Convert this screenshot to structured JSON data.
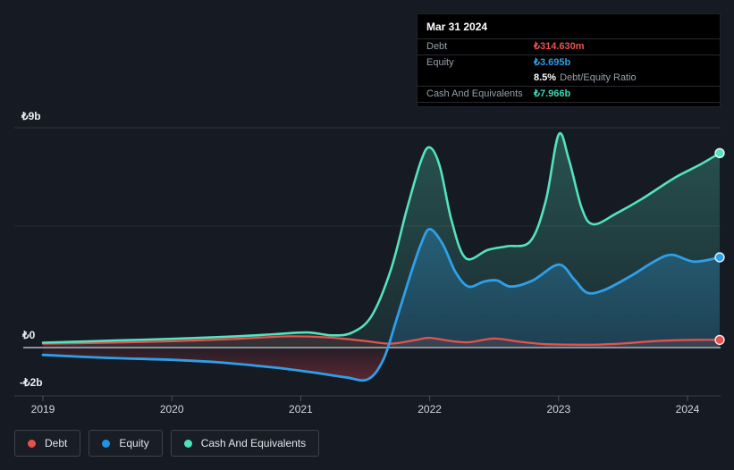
{
  "tooltip": {
    "date": "Mar 31 2024",
    "debt": {
      "label": "Debt",
      "value": "₺314.630m",
      "color": "#e8534e"
    },
    "equity": {
      "label": "Equity",
      "value": "₺3.695b",
      "color": "#2d9fe8"
    },
    "ratio": {
      "value": "8.5%",
      "label": "Debt/Equity Ratio"
    },
    "cash": {
      "label": "Cash And Equivalents",
      "value": "₺7.966b",
      "color": "#3bd6b3"
    }
  },
  "legend": {
    "items": [
      {
        "label": "Debt",
        "color": "#e4524e"
      },
      {
        "label": "Equity",
        "color": "#2391e5"
      },
      {
        "label": "Cash And Equivalents",
        "color": "#4fe0bd"
      }
    ]
  },
  "chart_data": {
    "type": "area",
    "x_axis": {
      "labels": [
        "2019",
        "2020",
        "2021",
        "2022",
        "2023",
        "2024"
      ],
      "range": [
        2019,
        2024.25
      ]
    },
    "y_axis": {
      "unit": "₺ billions",
      "labels": [
        {
          "text": "₺9b",
          "value": 9
        },
        {
          "text": "₺0",
          "value": 0
        },
        {
          "text": "-₺2b",
          "value": -2
        }
      ],
      "ylim": [
        -2,
        9
      ],
      "gridline_values": [
        9,
        5,
        0
      ]
    },
    "series": [
      {
        "key": "debt",
        "name": "Debt",
        "color": "#e4524e",
        "points": [
          [
            2019.0,
            0.16
          ],
          [
            2019.5,
            0.2
          ],
          [
            2020.0,
            0.26
          ],
          [
            2020.5,
            0.36
          ],
          [
            2020.9,
            0.46
          ],
          [
            2021.2,
            0.42
          ],
          [
            2021.5,
            0.27
          ],
          [
            2021.7,
            0.16
          ],
          [
            2021.9,
            0.32
          ],
          [
            2022.0,
            0.4
          ],
          [
            2022.15,
            0.28
          ],
          [
            2022.3,
            0.22
          ],
          [
            2022.5,
            0.37
          ],
          [
            2022.7,
            0.24
          ],
          [
            2022.9,
            0.14
          ],
          [
            2023.1,
            0.12
          ],
          [
            2023.3,
            0.12
          ],
          [
            2023.5,
            0.17
          ],
          [
            2023.7,
            0.25
          ],
          [
            2023.9,
            0.3
          ],
          [
            2024.1,
            0.32
          ],
          [
            2024.25,
            0.315
          ]
        ]
      },
      {
        "key": "equity",
        "name": "Equity",
        "color": "#2f9fe8",
        "points": [
          [
            2019.0,
            -0.3
          ],
          [
            2019.5,
            -0.42
          ],
          [
            2020.0,
            -0.5
          ],
          [
            2020.4,
            -0.62
          ],
          [
            2020.8,
            -0.82
          ],
          [
            2021.1,
            -1.02
          ],
          [
            2021.35,
            -1.22
          ],
          [
            2021.52,
            -1.3
          ],
          [
            2021.64,
            -0.5
          ],
          [
            2021.74,
            1.1
          ],
          [
            2021.84,
            2.8
          ],
          [
            2021.93,
            4.2
          ],
          [
            2022.0,
            4.85
          ],
          [
            2022.1,
            4.25
          ],
          [
            2022.2,
            3.1
          ],
          [
            2022.3,
            2.5
          ],
          [
            2022.42,
            2.7
          ],
          [
            2022.52,
            2.75
          ],
          [
            2022.63,
            2.5
          ],
          [
            2022.8,
            2.75
          ],
          [
            2023.0,
            3.4
          ],
          [
            2023.12,
            2.8
          ],
          [
            2023.22,
            2.25
          ],
          [
            2023.35,
            2.35
          ],
          [
            2023.55,
            2.9
          ],
          [
            2023.75,
            3.55
          ],
          [
            2023.88,
            3.8
          ],
          [
            2024.05,
            3.52
          ],
          [
            2024.25,
            3.695
          ]
        ]
      },
      {
        "key": "cash",
        "name": "Cash And Equivalents",
        "color": "#55e2bf",
        "points": [
          [
            2019.0,
            0.2
          ],
          [
            2019.5,
            0.28
          ],
          [
            2020.0,
            0.36
          ],
          [
            2020.5,
            0.46
          ],
          [
            2020.8,
            0.55
          ],
          [
            2021.05,
            0.62
          ],
          [
            2021.25,
            0.5
          ],
          [
            2021.4,
            0.62
          ],
          [
            2021.55,
            1.3
          ],
          [
            2021.7,
            3.2
          ],
          [
            2021.82,
            5.6
          ],
          [
            2021.93,
            7.6
          ],
          [
            2022.0,
            8.2
          ],
          [
            2022.08,
            7.4
          ],
          [
            2022.17,
            5.2
          ],
          [
            2022.28,
            3.66
          ],
          [
            2022.45,
            4.0
          ],
          [
            2022.6,
            4.15
          ],
          [
            2022.78,
            4.35
          ],
          [
            2022.9,
            6.0
          ],
          [
            2023.0,
            8.72
          ],
          [
            2023.08,
            7.7
          ],
          [
            2023.18,
            5.7
          ],
          [
            2023.27,
            5.05
          ],
          [
            2023.45,
            5.5
          ],
          [
            2023.65,
            6.1
          ],
          [
            2023.9,
            6.95
          ],
          [
            2024.1,
            7.5
          ],
          [
            2024.25,
            7.966
          ]
        ]
      }
    ]
  }
}
